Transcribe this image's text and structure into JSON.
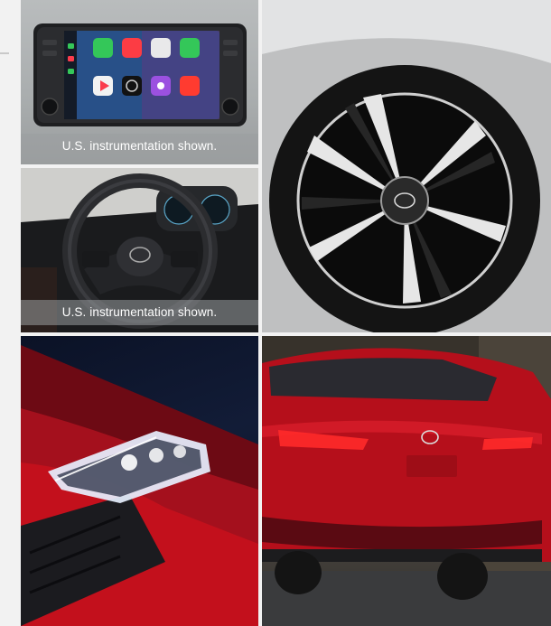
{
  "tiles": [
    {
      "id": "infotainment",
      "caption": "U.S. instrumentation shown."
    },
    {
      "id": "steering-wheel",
      "caption": "U.S. instrumentation shown."
    },
    {
      "id": "alloy-wheel",
      "caption": ""
    },
    {
      "id": "headlight",
      "caption": ""
    },
    {
      "id": "rear-view",
      "caption": ""
    }
  ],
  "colors": {
    "accent_red": "#c3101c",
    "caption_overlay": "#9b9ea0",
    "caption_text": "#ffffff"
  },
  "icons": [
    "phone-icon",
    "music-icon",
    "maps-icon",
    "messages-icon",
    "play-icon",
    "podcast-icon",
    "news-icon",
    "nissan-logo-icon"
  ]
}
